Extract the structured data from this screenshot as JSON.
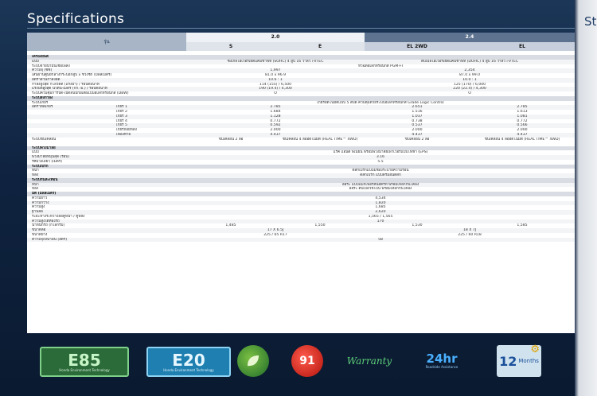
{
  "page": {
    "title": "Specifications"
  },
  "right_page": {
    "title": "Sta"
  },
  "table": {
    "model_header": "รุ่น",
    "engine_groups": [
      "2.0",
      "2.4"
    ],
    "grades": [
      "S",
      "E",
      "EL 2WD",
      "EL"
    ],
    "rows": [
      {
        "t": "section",
        "label": "เครื่องยนต์"
      },
      {
        "label": "แบบ",
        "left": "ซิงเกิลโอเวอร์เฮดแคมชาฟท์ (SOHC) 4 สูบ 16 วาล์ว i-VTEC",
        "right": "ดับเบิลโอเวอร์เฮดแคมชาฟท์ (DOHC) 4 สูบ 16 วาล์ว i-VTEC"
      },
      {
        "label": "ระบบจ่ายน้ำมันเชื้อเพลิง",
        "all": "หัวฉีดอิเล็กทรอนิกส์ PGM-FI"
      },
      {
        "label": "ความจุ (ซีซี)",
        "left": "1,997",
        "right": "2,354"
      },
      {
        "label": "เส้นผ่านศูนย์กลางกระบอกสูบ x ช่วงชัก (มิลลิเมตร)",
        "left": "81.0 x 96.9",
        "right": "87.0 x 99.0"
      },
      {
        "label": "อัตราส่วนกำลังอัด",
        "left": "10.6 : 1",
        "right": "10.0 : 1"
      },
      {
        "label": "กำลังสูงสุด กิโลวัตต์ (แรงม้า) / รอบต่อนาที",
        "left": "114 (155) / 6,500",
        "right": "125 (170) / 6,000"
      },
      {
        "label": "แรงบิดสูงสุด นิวตัน-เมตร (กก.-ม.) / รอบต่อนาที",
        "left": "190 (19.4) / 4,300",
        "right": "220 (22.4) / 4,300"
      },
      {
        "label": "ระบบควบคุมการปิด-เปิดลิ้นปีกผีเสื้อแบบอิเล็กทรอนิกส์ (DBW)",
        "left": "O",
        "right": "O"
      },
      {
        "t": "section",
        "label": "ระบบส่งกำลัง"
      },
      {
        "label": "ระบบเกียร์",
        "all": "เกียร์อัตโนมัติแบบ 5 สปีด ควบคุมด้วยระบบอิเล็กทรอนิกส์ Grade Logic Control"
      },
      {
        "label": "อัตราทดเกียร์",
        "sub": "เกียร์ 1",
        "left": "2.785",
        "c3": "2.651",
        "c4": "2.785"
      },
      {
        "label": "",
        "sub": "เกียร์ 2",
        "left": "1.684",
        "c3": "1.516",
        "c4": "1.613"
      },
      {
        "label": "",
        "sub": "เกียร์ 3",
        "left": "1.128",
        "c3": "1.037",
        "c4": "1.081"
      },
      {
        "label": "",
        "sub": "เกียร์ 4",
        "left": "0.772",
        "c3": "0.738",
        "c4": "0.772"
      },
      {
        "label": "",
        "sub": "เกียร์ 5",
        "left": "0.592",
        "c3": "0.537",
        "c4": "0.566"
      },
      {
        "label": "",
        "sub": "เกียร์ถอยหลัง",
        "left": "2.000",
        "c3": "2.000",
        "c4": "2.000"
      },
      {
        "label": "",
        "sub": "เฟืองท้าย",
        "left": "4.437",
        "c3": "4.437",
        "c4": "4.437"
      },
      {
        "label": "ระบบขับเคลื่อน",
        "c1": "ขับเคลื่อน 2 ล้อ",
        "c2": "ขับเคลื่อน 4 ล้ออัตโนมัติ (REAL TIME™ 4WD)",
        "c3": "ขับเคลื่อน 2 ล้อ",
        "c4": "ขับเคลื่อน 4 ล้ออัตโนมัติ (REAL TIME™ 4WD)",
        "tall": true
      },
      {
        "t": "section",
        "label": "ระบบพวงมาลัย"
      },
      {
        "label": "แบบ",
        "all": "แร็ค แอนด์ พีเนียน พร้อมพวงมาลัยเพาเวอร์แบบไฟฟ้า (EPS)"
      },
      {
        "label": "พวงมาลัยหมุนสุด (รอบ)",
        "all": "3.16"
      },
      {
        "label": "รัศมีวงเลี้ยว (เมตร)",
        "all": "5.5"
      },
      {
        "t": "section",
        "label": "ระบบเบรก"
      },
      {
        "label": "หน้า",
        "all": "ดิสก์เบรกแบบมีช่องระบายความร้อน"
      },
      {
        "label": "หลัง",
        "all": "ดิสก์เบรก แบบดรัมอินดิสก์"
      },
      {
        "t": "section",
        "label": "ระบบกันสะเทือน"
      },
      {
        "label": "หน้า",
        "all": "อิสระ แบบแม็กเฟอร์สันสตรัท พร้อมเหล็กกันโคลง"
      },
      {
        "label": "หลัง",
        "all": "อิสระ ดับเบิลวิชโบน พร้อมเหล็กกันโคลง"
      },
      {
        "t": "section",
        "label": "มิติ (มิลลิเมตร)"
      },
      {
        "label": "ความยาว",
        "all": "4,534"
      },
      {
        "label": "ความกว้าง",
        "all": "1,820"
      },
      {
        "label": "ความสูง",
        "all": "1,685"
      },
      {
        "label": "ฐานล้อ",
        "all": "2,620"
      },
      {
        "label": "ระยะห่างระหว่างล้อคู่หน้า / คู่หลัง",
        "all": "1,565 / 1,565"
      },
      {
        "label": "ความสูงใต้ท้องรถ",
        "all": "170"
      },
      {
        "label": "น้ำหนักรถ (กิโลกรัม)",
        "c1": "1,485",
        "c2": "1,550",
        "c3": "1,530",
        "c4": "1,585"
      },
      {
        "label": "ขนาดล้อ",
        "left": "17 X 6.5J",
        "right": "18 X 7J"
      },
      {
        "label": "ขนาดยาง",
        "left": "225 / 65 R17",
        "right": "225 / 60 R18"
      },
      {
        "label": "ความจุถังน้ำมัน (ลิตร)",
        "all": "58"
      }
    ]
  },
  "footer": {
    "e85": {
      "text": "E85",
      "sub": "Honda Environment Technology"
    },
    "e20": {
      "text": "E20",
      "sub": "Honda Environment Technology"
    },
    "fuel91": {
      "text": "91"
    },
    "warranty": {
      "text": "Warranty"
    },
    "h24": {
      "text": "24hr",
      "sub": "Roadside Assistance"
    },
    "m12": {
      "num": "12",
      "text": "Months"
    }
  },
  "colors": {
    "page_bg": "#0f2340",
    "header_20": "#eef1f5",
    "header_24": "#5e7390",
    "section_bg": "#d9dde3"
  }
}
